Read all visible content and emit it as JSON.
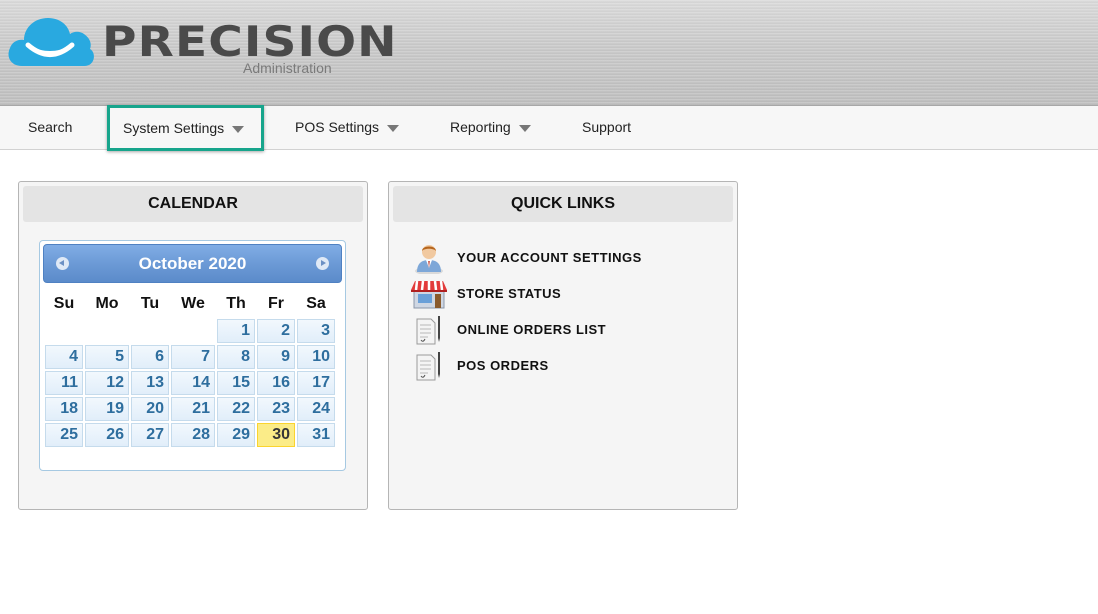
{
  "brand": {
    "name": "PRECISION",
    "subtitle": "Administration",
    "cloud_color": "#29a9e0"
  },
  "nav": {
    "items": [
      {
        "label": "Search",
        "dropdown": false
      },
      {
        "label": "System Settings",
        "dropdown": true,
        "active": true
      },
      {
        "label": "POS Settings",
        "dropdown": true
      },
      {
        "label": "Reporting",
        "dropdown": true
      },
      {
        "label": "Support",
        "dropdown": false
      }
    ],
    "active_color": "#17a58c"
  },
  "calendar_panel": {
    "title": "CALENDAR",
    "month_label": "October 2020",
    "weekdays": [
      "Su",
      "Mo",
      "Tu",
      "We",
      "Th",
      "Fr",
      "Sa"
    ],
    "weeks": [
      [
        "",
        "",
        "",
        "",
        "1",
        "2",
        "3"
      ],
      [
        "4",
        "5",
        "6",
        "7",
        "8",
        "9",
        "10"
      ],
      [
        "11",
        "12",
        "13",
        "14",
        "15",
        "16",
        "17"
      ],
      [
        "18",
        "19",
        "20",
        "21",
        "22",
        "23",
        "24"
      ],
      [
        "25",
        "26",
        "27",
        "28",
        "29",
        "30",
        "31"
      ]
    ],
    "today": "30"
  },
  "quick_links_panel": {
    "title": "QUICK LINKS",
    "links": [
      {
        "label": "YOUR ACCOUNT SETTINGS",
        "icon": "user-icon"
      },
      {
        "label": "STORE STATUS",
        "icon": "store-icon"
      },
      {
        "label": "ONLINE ORDERS LIST",
        "icon": "document-pen-icon"
      },
      {
        "label": "POS ORDERS",
        "icon": "document-pen-icon"
      }
    ]
  }
}
